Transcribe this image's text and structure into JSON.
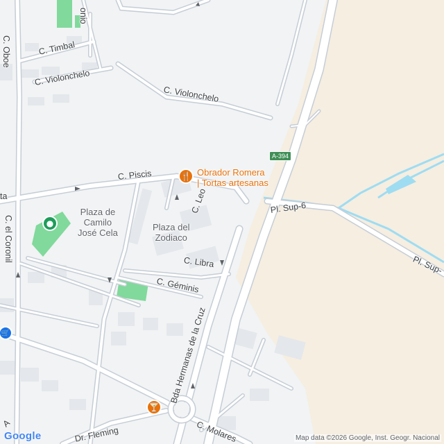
{
  "map": {
    "streets": {
      "oboe": "C. Oboe",
      "timbal": "C. Timbal",
      "violonchelo_left": "C. Violonchelo",
      "violonchelo_right": "C. Violonchelo",
      "piscis": "C. Piscis",
      "leo": "C. Leo",
      "libra": "C. Libra",
      "geminis": "C. Géminis",
      "coronil": "C. el Coronil",
      "hermanas": "Bda Hermanas de la Cruz",
      "molares": "C. Molares",
      "fleming": "Dr. Fleming",
      "pl_sup_6": "Pl. Sup-6",
      "pl_sup_right": "Pl. Sup-",
      "onio": "onio",
      "ta": "ta",
      "a_left": "A"
    },
    "places": {
      "camilo": "Plaza de\nCamilo\nJosé Cela",
      "zodiaco": "Plaza del\nZodiaco"
    },
    "poi": {
      "obrador": "Obrador Romera\n| Tortas artesanas"
    },
    "route_shield": "A-394",
    "attribution": "Map data ©2026 Google, Inst. Geogr. Nacional",
    "logo": "Google",
    "icons": [
      "restaurant-pin-icon",
      "park-pin-icon",
      "shopping-cart-pin-icon",
      "bar-pin-icon"
    ],
    "colors": {
      "background": "#f1f3f4",
      "sand": "#f5eee1",
      "park": "#81d99c",
      "water": "#9edcf2",
      "road": "#ffffff",
      "road_edge": "#c6cdd6",
      "building": "#e4e7eb",
      "poi_orange": "#e8710a",
      "park_green": "#1e9c5a",
      "shop_blue": "#1a73e8",
      "shield_green": "#3f8f56"
    }
  }
}
